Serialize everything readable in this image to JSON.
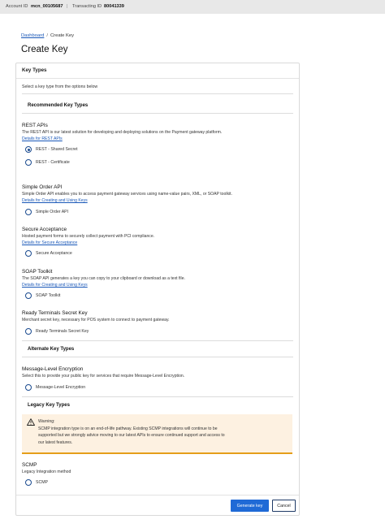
{
  "topbar": {
    "account_label": "Account ID",
    "account_value": "mcn_00105687",
    "separator": "|",
    "transacting_label": "Transacting ID",
    "transacting_value": "80041339"
  },
  "breadcrumb": {
    "dashboard": "Dashboard",
    "separator": "/",
    "current": "Create Key"
  },
  "page_title": "Create Key",
  "card": {
    "header": "Key Types",
    "intro": "Select a key type from the options below",
    "groups": {
      "recommended": "Recommended Key Types",
      "alternate": "Alternate Key Types",
      "legacy": "Legacy Key Types"
    },
    "sections": {
      "rest": {
        "title": "REST APIs",
        "desc": "The REST API is our latest solution for developing and deploying solutions on the Payment gateway platform.",
        "link": "Details for REST APIs",
        "options": [
          "REST - Shared Secret",
          "REST - Certificate"
        ],
        "selected": "REST - Shared Secret"
      },
      "simple_order": {
        "title": "Simple Order API",
        "desc": "Simple Order API enables you to access payment gateway services using name-value pairs, XML, or SOAP toolkit.",
        "link": "Details for Creating and Using Keys",
        "option": "Simple Order API"
      },
      "secure_acceptance": {
        "title": "Secure Acceptance",
        "desc": "Hosted payment forms to securely collect payment with PCI compliance.",
        "link": "Details for Secure Acceptance",
        "option": "Secure Acceptance"
      },
      "soap": {
        "title": "SOAP Toolkit",
        "desc": "The SOAP API generates a key you can copy to your clipboard or download as a text file.",
        "link": "Details for Creating and Using Keys",
        "option": "SOAP Toolkit"
      },
      "ready_terminals": {
        "title": "Ready Terminals Secret Key",
        "desc": "Merchant secret key, necessary for POS system to connect to payment gateway.",
        "option": "Ready Terminals Secret Key"
      },
      "mle": {
        "title": "Message-Level Encryption",
        "desc": "Select this to provide your public key for services that require Message-Level Encryption.",
        "option": "Message-Level Encryption"
      },
      "scmp": {
        "title": "SCMP",
        "desc": "Legacy Integration method",
        "option": "SCMP"
      }
    },
    "warning": {
      "title": "Warning:",
      "line1": "SCMP integration type is on an end-of-life pathway. Existing SCMP integrations will continue to be",
      "line2": "supported but we strongly advice moving to our latest APIs to ensure continued support and access to",
      "line3": "our latest features."
    },
    "buttons": {
      "generate": "Generate key",
      "cancel": "Cancel"
    }
  },
  "colors": {
    "primary": "#1f6ad6",
    "link": "#1a58b8",
    "warning_bg": "#fdf1e1",
    "warning_accent": "#e59e1a"
  },
  "icons": {
    "warning": "warning-triangle-icon"
  }
}
